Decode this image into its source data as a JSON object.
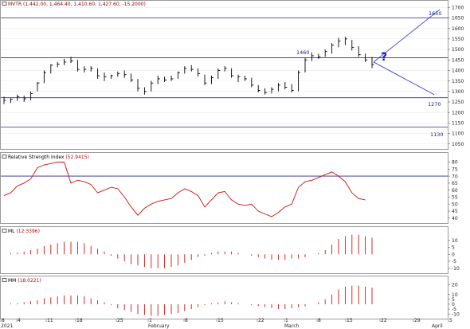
{
  "panels": {
    "price": {
      "label": "MVTR (1,442.00, 1,464.40, 1,410.60, 1,427.60, -15.2000)",
      "y_ticks": [
        1050,
        1100,
        1150,
        1200,
        1250,
        1300,
        1350,
        1400,
        1450,
        1500,
        1550,
        1600,
        1650,
        1700
      ]
    },
    "rsi": {
      "label": "Relative Strength Index",
      "value": "(52.9415)",
      "y_ticks": [
        40,
        45,
        50,
        55,
        60,
        65,
        70,
        75,
        80
      ]
    },
    "ml": {
      "label": "ML",
      "value": "(12.3396)",
      "y_ticks": [
        -10,
        -5,
        0,
        5,
        10
      ]
    },
    "mm": {
      "label": "MM",
      "value": "(18.0221)",
      "y_ticks": [
        -10,
        -5,
        0,
        5,
        10,
        20
      ]
    }
  },
  "annotations": {
    "levels": [
      {
        "value": 1650,
        "label": "1650"
      },
      {
        "value": 1460,
        "label": "1460"
      },
      {
        "value": 1270,
        "label": "1270"
      },
      {
        "value": 1130,
        "label": "1130"
      }
    ],
    "question_mark": "?"
  },
  "x_axis": {
    "ticks": [
      {
        "label": "8"
      },
      {
        "label": "4"
      },
      {
        "label": "11"
      },
      {
        "label": "18"
      },
      {
        "label": "25"
      },
      {
        "label": "1"
      },
      {
        "label": "8"
      },
      {
        "label": "15"
      },
      {
        "label": "22"
      },
      {
        "label": "1"
      },
      {
        "label": "8"
      },
      {
        "label": "15"
      },
      {
        "label": "22"
      },
      {
        "label": "29"
      },
      {
        "label": "5"
      }
    ],
    "months": [
      {
        "label": "2021"
      },
      {
        "label": "February"
      },
      {
        "label": "March"
      },
      {
        "label": "April"
      }
    ]
  },
  "chart_data": {
    "type": "line",
    "price_bars": [
      {
        "h": 1275,
        "l": 1240,
        "c": 1258
      },
      {
        "h": 1268,
        "l": 1245,
        "c": 1262
      },
      {
        "h": 1285,
        "l": 1255,
        "c": 1275
      },
      {
        "h": 1280,
        "l": 1250,
        "c": 1265
      },
      {
        "h": 1300,
        "l": 1258,
        "c": 1290
      },
      {
        "h": 1345,
        "l": 1300,
        "c": 1340
      },
      {
        "h": 1400,
        "l": 1340,
        "c": 1390
      },
      {
        "h": 1430,
        "l": 1385,
        "c": 1425
      },
      {
        "h": 1440,
        "l": 1415,
        "c": 1430
      },
      {
        "h": 1455,
        "l": 1425,
        "c": 1440
      },
      {
        "h": 1465,
        "l": 1435,
        "c": 1445
      },
      {
        "h": 1450,
        "l": 1395,
        "c": 1405
      },
      {
        "h": 1420,
        "l": 1390,
        "c": 1405
      },
      {
        "h": 1420,
        "l": 1395,
        "c": 1410
      },
      {
        "h": 1410,
        "l": 1360,
        "c": 1375
      },
      {
        "h": 1390,
        "l": 1350,
        "c": 1370
      },
      {
        "h": 1380,
        "l": 1360,
        "c": 1375
      },
      {
        "h": 1395,
        "l": 1370,
        "c": 1385
      },
      {
        "h": 1400,
        "l": 1365,
        "c": 1380
      },
      {
        "h": 1385,
        "l": 1345,
        "c": 1355
      },
      {
        "h": 1360,
        "l": 1300,
        "c": 1315
      },
      {
        "h": 1320,
        "l": 1285,
        "c": 1300
      },
      {
        "h": 1350,
        "l": 1300,
        "c": 1340
      },
      {
        "h": 1375,
        "l": 1335,
        "c": 1360
      },
      {
        "h": 1370,
        "l": 1345,
        "c": 1355
      },
      {
        "h": 1375,
        "l": 1350,
        "c": 1360
      },
      {
        "h": 1395,
        "l": 1360,
        "c": 1390
      },
      {
        "h": 1420,
        "l": 1385,
        "c": 1410
      },
      {
        "h": 1425,
        "l": 1395,
        "c": 1405
      },
      {
        "h": 1410,
        "l": 1370,
        "c": 1385
      },
      {
        "h": 1380,
        "l": 1330,
        "c": 1340
      },
      {
        "h": 1375,
        "l": 1335,
        "c": 1365
      },
      {
        "h": 1410,
        "l": 1360,
        "c": 1400
      },
      {
        "h": 1420,
        "l": 1395,
        "c": 1410
      },
      {
        "h": 1410,
        "l": 1365,
        "c": 1375
      },
      {
        "h": 1380,
        "l": 1345,
        "c": 1370
      },
      {
        "h": 1375,
        "l": 1350,
        "c": 1360
      },
      {
        "h": 1365,
        "l": 1320,
        "c": 1330
      },
      {
        "h": 1330,
        "l": 1295,
        "c": 1305
      },
      {
        "h": 1315,
        "l": 1285,
        "c": 1295
      },
      {
        "h": 1320,
        "l": 1290,
        "c": 1310
      },
      {
        "h": 1340,
        "l": 1300,
        "c": 1330
      },
      {
        "h": 1345,
        "l": 1310,
        "c": 1320
      },
      {
        "h": 1335,
        "l": 1295,
        "c": 1305
      },
      {
        "h": 1400,
        "l": 1300,
        "c": 1390
      },
      {
        "h": 1460,
        "l": 1390,
        "c": 1450
      },
      {
        "h": 1485,
        "l": 1445,
        "c": 1470
      },
      {
        "h": 1480,
        "l": 1455,
        "c": 1465
      },
      {
        "h": 1500,
        "l": 1465,
        "c": 1490
      },
      {
        "h": 1530,
        "l": 1480,
        "c": 1520
      },
      {
        "h": 1555,
        "l": 1510,
        "c": 1540
      },
      {
        "h": 1560,
        "l": 1520,
        "c": 1550
      },
      {
        "h": 1545,
        "l": 1495,
        "c": 1510
      },
      {
        "h": 1515,
        "l": 1465,
        "c": 1475
      },
      {
        "h": 1480,
        "l": 1440,
        "c": 1450
      },
      {
        "h": 1464,
        "l": 1411,
        "c": 1428
      }
    ],
    "rsi": [
      56,
      58,
      63,
      65,
      68,
      76,
      78,
      79,
      80,
      80,
      65,
      67,
      66,
      64,
      58,
      60,
      62,
      61,
      55,
      48,
      42,
      47,
      50,
      52,
      53,
      54,
      58,
      61,
      59,
      56,
      48,
      53,
      58,
      59,
      53,
      50,
      49,
      50,
      45,
      43,
      41,
      44,
      48,
      50,
      62,
      66,
      67,
      69,
      71,
      73,
      70,
      66,
      58,
      54,
      53
    ],
    "ml": [
      0,
      1,
      1,
      2,
      3,
      4,
      6,
      7,
      8,
      9,
      9,
      9,
      8,
      6,
      4,
      2,
      -1,
      -3,
      -5,
      -7,
      -8,
      -9,
      -10,
      -10,
      -10,
      -9,
      -8,
      -6,
      -4,
      -2,
      -1,
      1,
      2,
      2,
      2,
      1,
      0,
      -1,
      -2,
      -3,
      -4,
      -4,
      -4,
      -3,
      -3,
      -2,
      0,
      1,
      3,
      7,
      11,
      13,
      14,
      14,
      13,
      12
    ],
    "mm": [
      0,
      1,
      1,
      2,
      3,
      4,
      6,
      7,
      8,
      9,
      9,
      9,
      8,
      6,
      4,
      2,
      -1,
      -4,
      -6,
      -8,
      -10,
      -11,
      -12,
      -12,
      -11,
      -10,
      -9,
      -7,
      -5,
      -3,
      -1,
      1,
      2,
      3,
      2,
      1,
      0,
      -1,
      -2,
      -3,
      -4,
      -5,
      -5,
      -4,
      -3,
      -2,
      0,
      2,
      5,
      10,
      15,
      18,
      19,
      19,
      18,
      17
    ]
  }
}
